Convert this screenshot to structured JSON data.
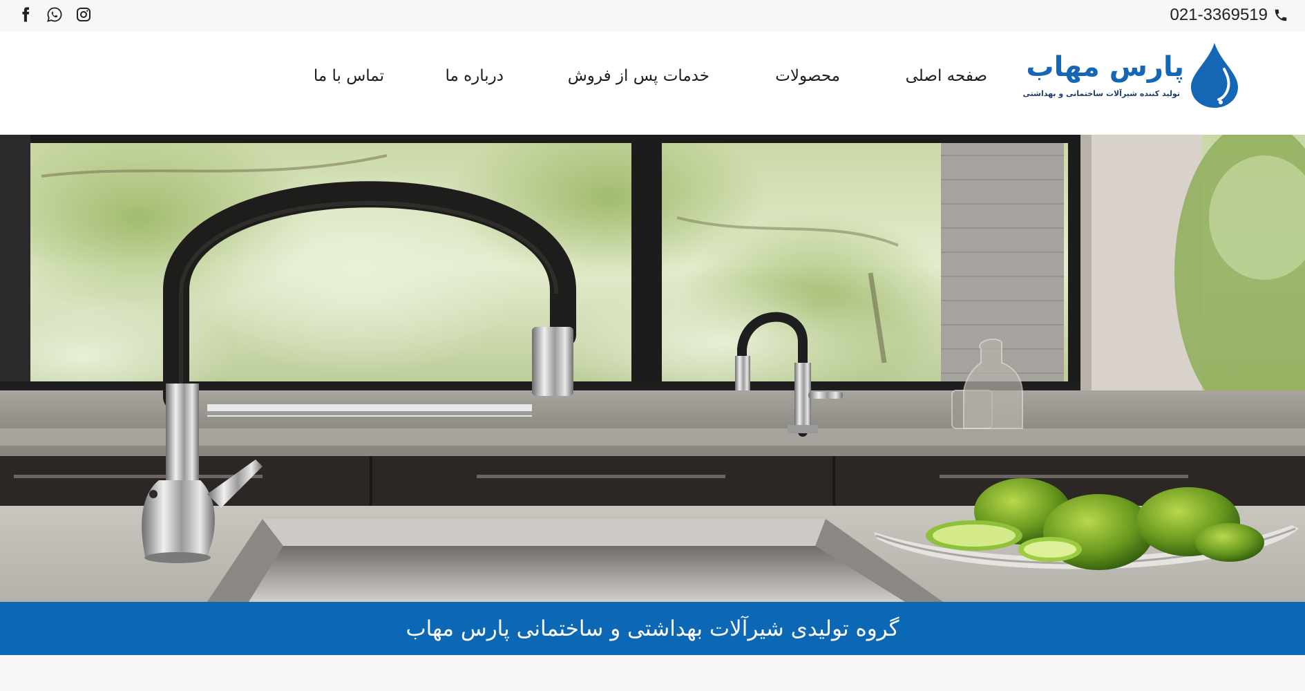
{
  "topbar": {
    "phone": "021-3369519",
    "phone_icon": "phone-icon",
    "socials": [
      "facebook-icon",
      "whatsapp-icon",
      "instagram-icon"
    ]
  },
  "logo": {
    "title": "پارس مهاب",
    "subtitle": "تولید کننده شیرآلات ساختمانی و بهداشتی",
    "brand_color": "#1567b5"
  },
  "nav": {
    "items": [
      {
        "label": "صفحه اصلی"
      },
      {
        "label": "محصولات"
      },
      {
        "label": "خدمات پس از فروش"
      },
      {
        "label": "درباره ما"
      },
      {
        "label": "تماس با ما"
      }
    ]
  },
  "hero": {
    "image": "kitchen-faucet-photo"
  },
  "banner": {
    "text": "گروه تولیدی شیرآلات بهداشتی و ساختمانی پارس مهاب",
    "color": "#0c68b4"
  }
}
